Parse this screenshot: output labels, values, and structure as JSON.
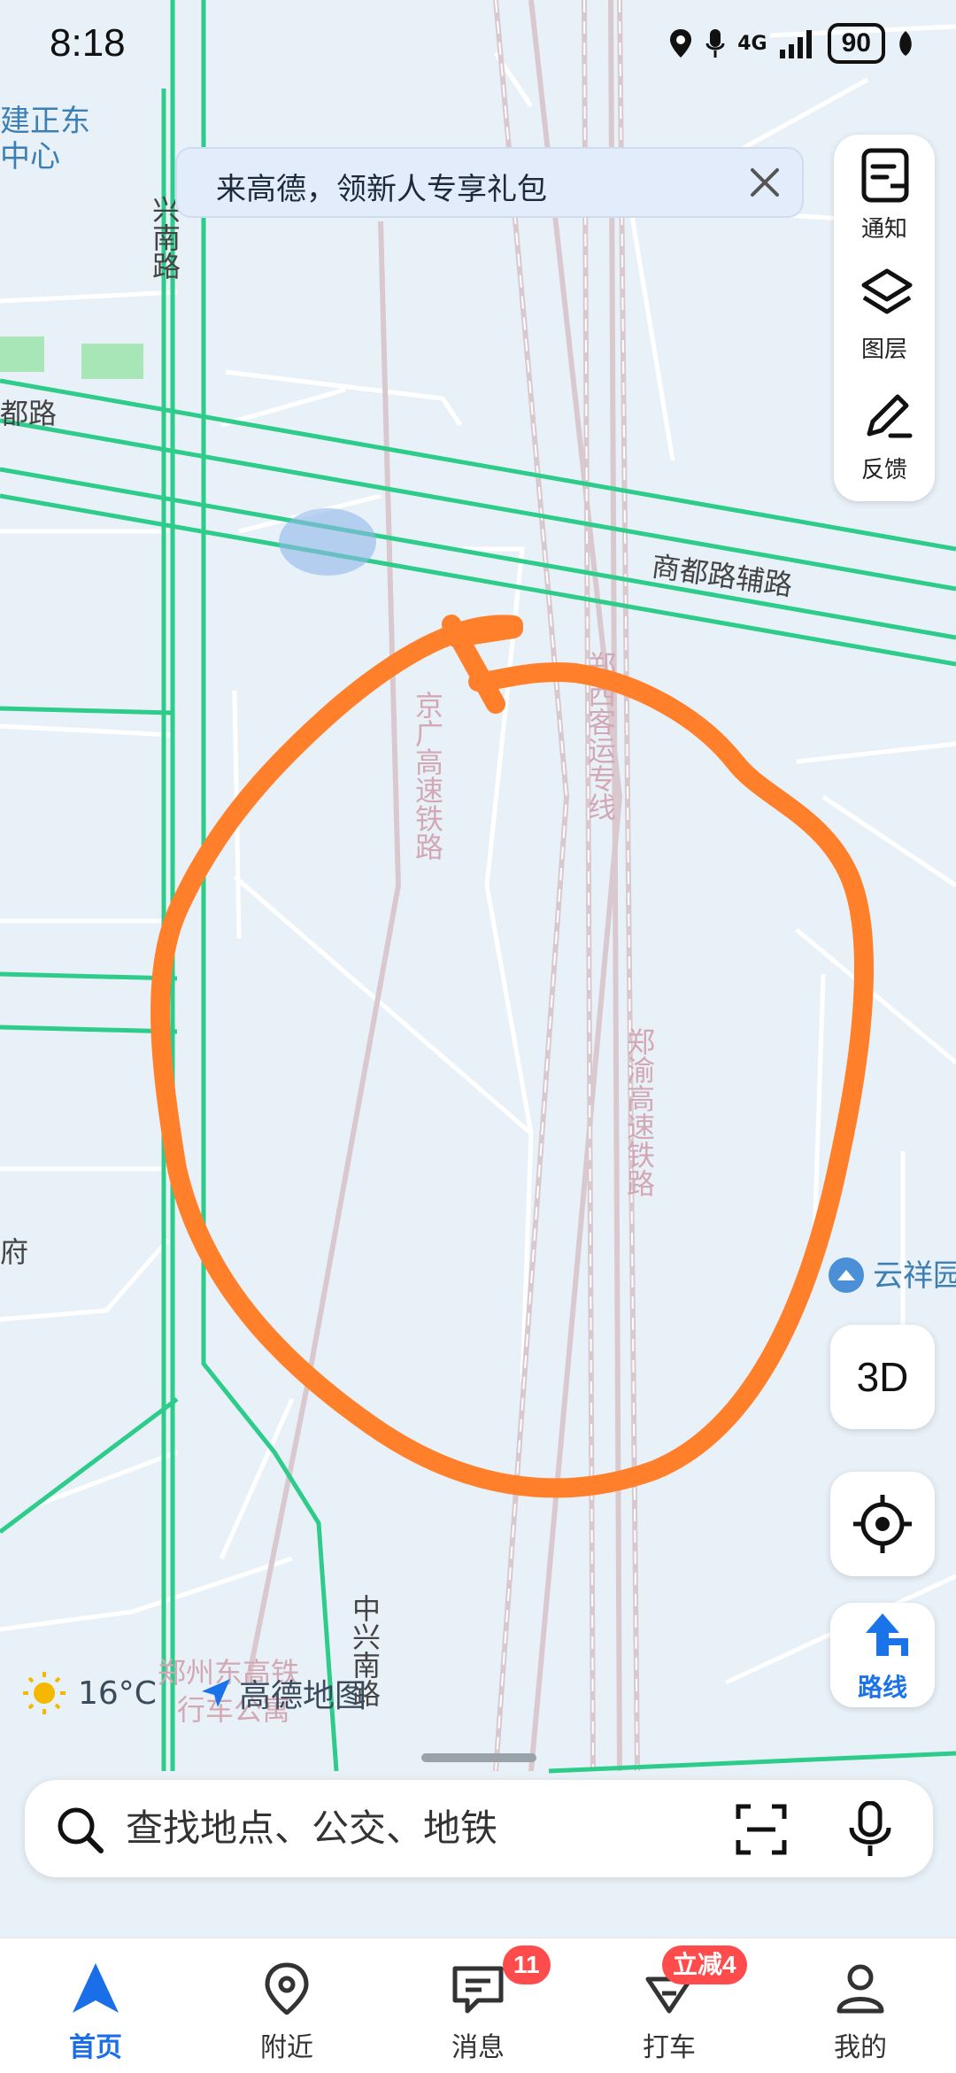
{
  "status_bar": {
    "time": "8:18",
    "network": "4G",
    "battery": "90"
  },
  "banner": {
    "text": "来高德，领新人专享礼包"
  },
  "tools": [
    {
      "label": "通知",
      "icon": "notification-icon"
    },
    {
      "label": "图层",
      "icon": "layers-icon"
    },
    {
      "label": "反馈",
      "icon": "feedback-pen-icon"
    }
  ],
  "map": {
    "labels": {
      "jianzheng": "建正东\n中心",
      "zhongxing_north": "中兴南路",
      "shangdu_road": "商都路",
      "shangdu_aux": "商都路辅路",
      "jingguang": "京广高速铁路",
      "zhengxi": "郑西客运专线",
      "zhengyu": "郑渝高速铁路",
      "yunxiang": "云祥园",
      "fu": "府",
      "zhongxing_south": "中兴南路",
      "apartment": "郑州东高铁\n行车公寓"
    },
    "colors": {
      "background": "#e9f1f8",
      "main_road": "#2ecc8a",
      "minor_road": "#ffffff",
      "railway": "#d9c9cf",
      "annotation": "#ff7f2a"
    }
  },
  "controls": {
    "three_d": "3D",
    "route": "路线"
  },
  "weather": {
    "temp": "16°C"
  },
  "logo": {
    "text": "高德地图"
  },
  "search": {
    "placeholder": "查找地点、公交、地铁"
  },
  "tabbar": {
    "items": [
      {
        "label": "首页",
        "icon": "home-arrow-icon",
        "active": true
      },
      {
        "label": "附近",
        "icon": "location-pin-icon"
      },
      {
        "label": "消息",
        "icon": "message-icon",
        "badge": "11"
      },
      {
        "label": "打车",
        "icon": "taxi-icon",
        "badge": "立减4"
      },
      {
        "label": "我的",
        "icon": "profile-icon"
      }
    ]
  }
}
